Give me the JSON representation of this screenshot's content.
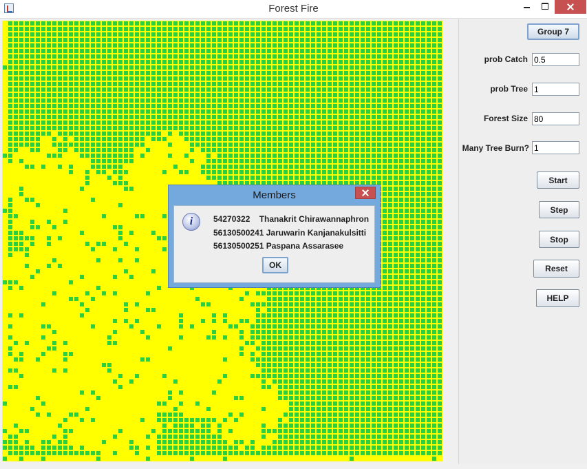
{
  "window": {
    "title": "Forest Fire",
    "icon": "java-cup-icon"
  },
  "forest": {
    "size": 80,
    "colors": {
      "tree": "#2ccf3f",
      "burned": "#ffff00",
      "cell_border": "#ffff00"
    },
    "burned_fraction": 0.4
  },
  "side_panel": {
    "group_button": "Group 7",
    "prob_catch": {
      "label": "prob Catch",
      "value": "0.5"
    },
    "prob_tree": {
      "label": "prob Tree",
      "value": "1"
    },
    "forest_size": {
      "label": "Forest Size",
      "value": "80"
    },
    "many_tree_burn": {
      "label": "Many Tree Burn?",
      "value": "1"
    },
    "buttons": {
      "start": "Start",
      "step": "Step",
      "stop": "Stop",
      "reset": "Reset",
      "help": "HELP"
    }
  },
  "dialog": {
    "title": "Members",
    "icon": "info-icon",
    "members": [
      "54270322    Thanakrit Chirawannaphron",
      "56130500241 Jaruwarin Kanjanakulsitti",
      "56130500251 Paspana Assarasee"
    ],
    "ok_label": "OK"
  }
}
